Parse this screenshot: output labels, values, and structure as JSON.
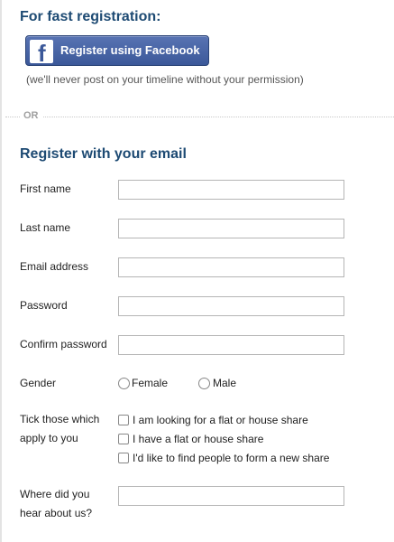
{
  "fast": {
    "title": "For fast registration:",
    "facebook_button": "Register using Facebook",
    "facebook_icon": "facebook-icon",
    "note": "(we'll never post on your timeline without your permission)"
  },
  "separator": {
    "or": "OR"
  },
  "email_section": {
    "title": "Register with your email",
    "fields": {
      "first_name": {
        "label": "First name",
        "value": ""
      },
      "last_name": {
        "label": "Last name",
        "value": ""
      },
      "email": {
        "label": "Email address",
        "value": ""
      },
      "password": {
        "label": "Password",
        "value": ""
      },
      "confirm_password": {
        "label": "Confirm password",
        "value": ""
      }
    },
    "gender": {
      "label": "Gender",
      "options": [
        {
          "label": "Female",
          "selected": false
        },
        {
          "label": "Male",
          "selected": false
        }
      ]
    },
    "tick": {
      "label": "Tick those which apply to you",
      "options": [
        {
          "label": "I am looking for a flat or house share",
          "checked": false
        },
        {
          "label": "I have a flat or house share",
          "checked": false
        },
        {
          "label": "I'd like to find people to form a new share",
          "checked": false
        }
      ]
    },
    "heard": {
      "label": "Where did you hear about us?",
      "value": ""
    }
  },
  "colors": {
    "heading": "#1d4a73",
    "facebook": "#3b5899"
  }
}
